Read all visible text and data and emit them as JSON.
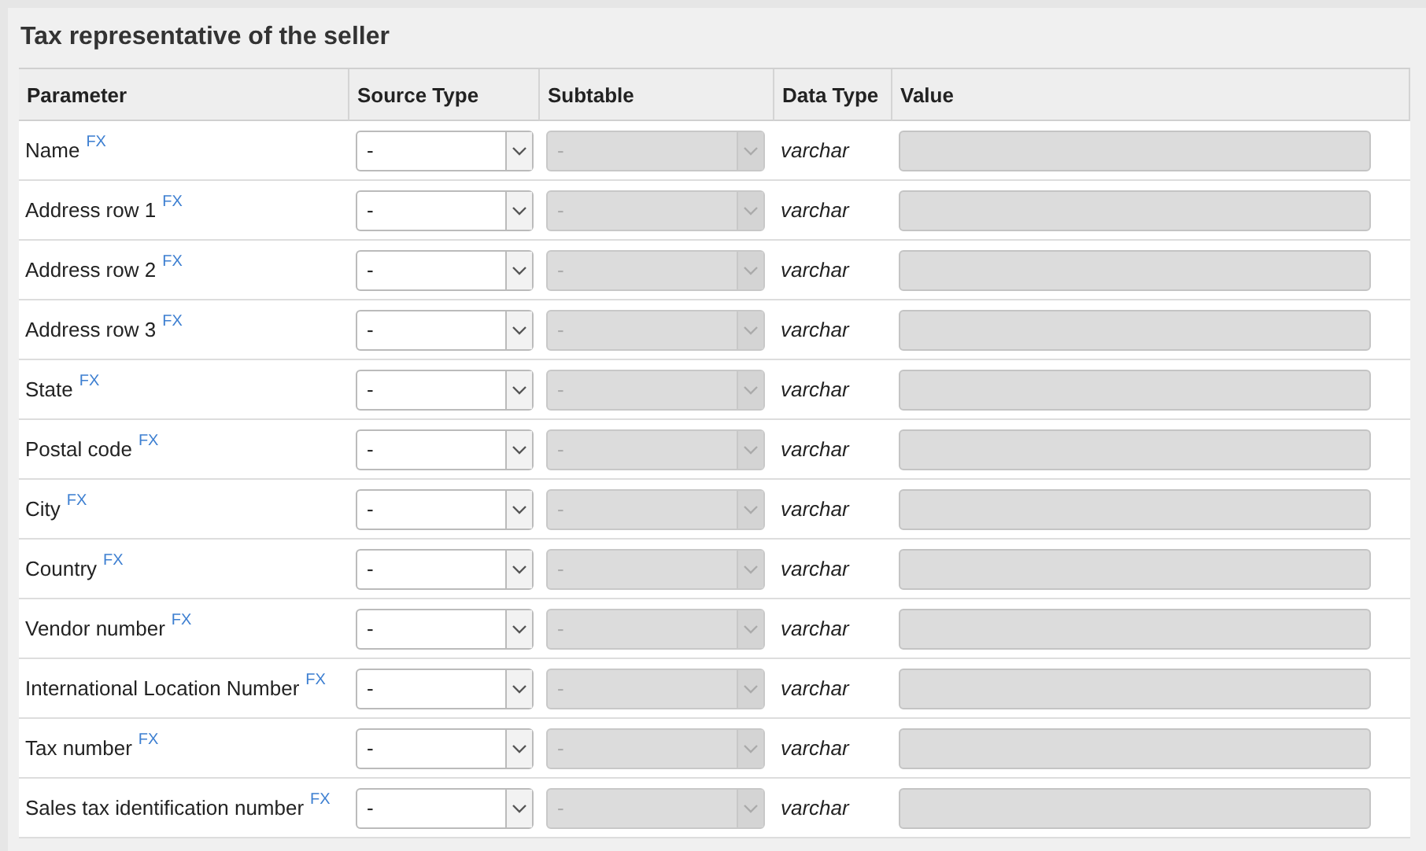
{
  "section": {
    "title": "Tax representative of the seller"
  },
  "table": {
    "columns": [
      "Parameter",
      "Source Type",
      "Subtable",
      "Data Type",
      "Value"
    ],
    "rows": [
      {
        "parameter": "Name",
        "fx": "FX",
        "source_type": {
          "value": "-",
          "disabled": false
        },
        "subtable": {
          "value": "-",
          "disabled": true
        },
        "data_type": "varchar",
        "value_field": {
          "disabled": true
        }
      },
      {
        "parameter": "Address row 1",
        "fx": "FX",
        "source_type": {
          "value": "-",
          "disabled": false
        },
        "subtable": {
          "value": "-",
          "disabled": true
        },
        "data_type": "varchar",
        "value_field": {
          "disabled": true
        }
      },
      {
        "parameter": "Address row 2",
        "fx": "FX",
        "source_type": {
          "value": "-",
          "disabled": false
        },
        "subtable": {
          "value": "-",
          "disabled": true
        },
        "data_type": "varchar",
        "value_field": {
          "disabled": true
        }
      },
      {
        "parameter": "Address row 3",
        "fx": "FX",
        "source_type": {
          "value": "-",
          "disabled": false
        },
        "subtable": {
          "value": "-",
          "disabled": true
        },
        "data_type": "varchar",
        "value_field": {
          "disabled": true
        }
      },
      {
        "parameter": "State",
        "fx": "FX",
        "source_type": {
          "value": "-",
          "disabled": false
        },
        "subtable": {
          "value": "-",
          "disabled": true
        },
        "data_type": "varchar",
        "value_field": {
          "disabled": true
        }
      },
      {
        "parameter": "Postal code",
        "fx": "FX",
        "source_type": {
          "value": "-",
          "disabled": false
        },
        "subtable": {
          "value": "-",
          "disabled": true
        },
        "data_type": "varchar",
        "value_field": {
          "disabled": true
        }
      },
      {
        "parameter": "City",
        "fx": "FX",
        "source_type": {
          "value": "-",
          "disabled": false
        },
        "subtable": {
          "value": "-",
          "disabled": true
        },
        "data_type": "varchar",
        "value_field": {
          "disabled": true
        }
      },
      {
        "parameter": "Country",
        "fx": "FX",
        "source_type": {
          "value": "-",
          "disabled": false
        },
        "subtable": {
          "value": "-",
          "disabled": true
        },
        "data_type": "varchar",
        "value_field": {
          "disabled": true
        }
      },
      {
        "parameter": "Vendor number",
        "fx": "FX",
        "source_type": {
          "value": "-",
          "disabled": false
        },
        "subtable": {
          "value": "-",
          "disabled": true
        },
        "data_type": "varchar",
        "value_field": {
          "disabled": true
        }
      },
      {
        "parameter": "International Location Number",
        "fx": "FX",
        "source_type": {
          "value": "-",
          "disabled": false
        },
        "subtable": {
          "value": "-",
          "disabled": true
        },
        "data_type": "varchar",
        "value_field": {
          "disabled": true
        }
      },
      {
        "parameter": "Tax number",
        "fx": "FX",
        "source_type": {
          "value": "-",
          "disabled": false
        },
        "subtable": {
          "value": "-",
          "disabled": true
        },
        "data_type": "varchar",
        "value_field": {
          "disabled": true
        }
      },
      {
        "parameter": "Sales tax identification number",
        "fx": "FX",
        "source_type": {
          "value": "-",
          "disabled": false
        },
        "subtable": {
          "value": "-",
          "disabled": true
        },
        "data_type": "varchar",
        "value_field": {
          "disabled": true
        }
      }
    ]
  }
}
